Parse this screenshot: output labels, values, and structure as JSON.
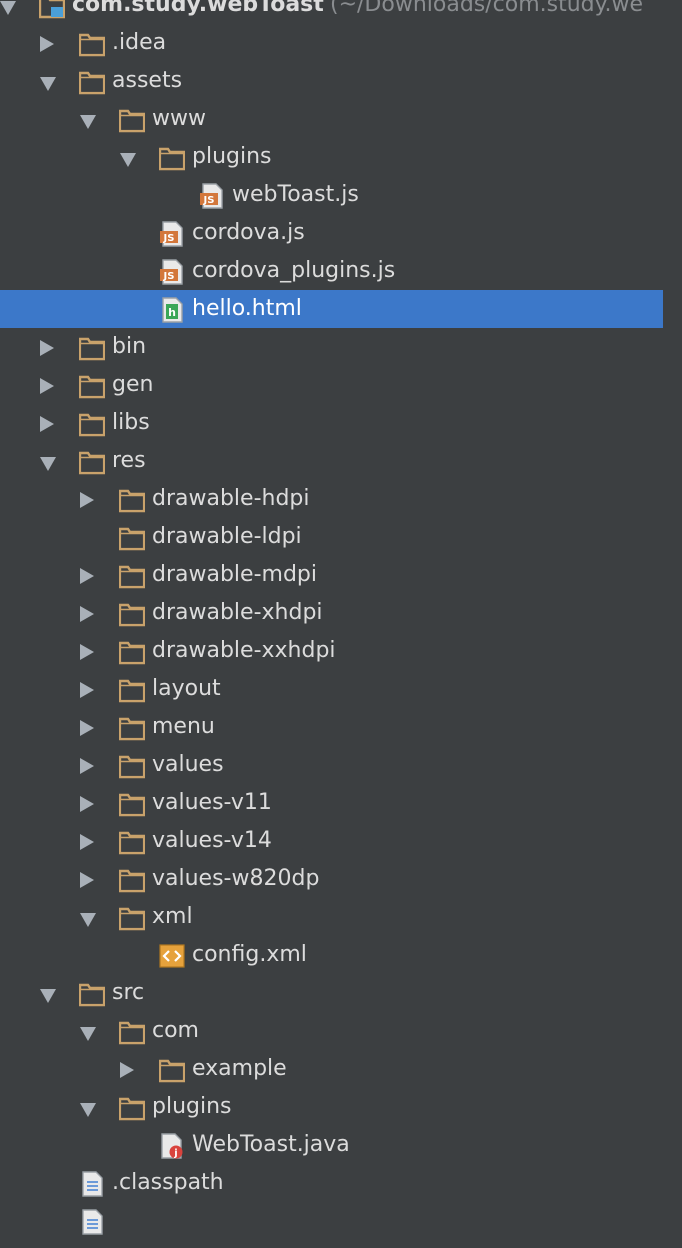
{
  "window": {
    "title": "com.study.webToast"
  },
  "tree": [
    {
      "label": "com.study.webToast",
      "suffix": " (~/Downloads/com.study.we",
      "depth": 0,
      "type": "module",
      "arrow": "expanded",
      "name": "tree-root"
    },
    {
      "label": ".idea",
      "depth": 1,
      "type": "folder",
      "arrow": "collapsed",
      "name": "tree-item-idea"
    },
    {
      "label": "assets",
      "depth": 1,
      "type": "folder",
      "arrow": "expanded",
      "name": "tree-item-assets"
    },
    {
      "label": "www",
      "depth": 2,
      "type": "folder",
      "arrow": "expanded",
      "name": "tree-item-www"
    },
    {
      "label": "plugins",
      "depth": 3,
      "type": "folder",
      "arrow": "expanded",
      "name": "tree-item-www-plugins"
    },
    {
      "label": "webToast.js",
      "depth": 4,
      "type": "js",
      "arrow": "none",
      "name": "tree-item-webtoast-js"
    },
    {
      "label": "cordova.js",
      "depth": 3,
      "type": "js",
      "arrow": "none",
      "name": "tree-item-cordova-js"
    },
    {
      "label": "cordova_plugins.js",
      "depth": 3,
      "type": "js",
      "arrow": "none",
      "name": "tree-item-cordova-plugins-js"
    },
    {
      "label": "hello.html",
      "depth": 3,
      "type": "html",
      "arrow": "none",
      "selected": true,
      "name": "tree-item-hello-html"
    },
    {
      "label": "bin",
      "depth": 1,
      "type": "folder",
      "arrow": "collapsed",
      "name": "tree-item-bin"
    },
    {
      "label": "gen",
      "depth": 1,
      "type": "folder",
      "arrow": "collapsed",
      "name": "tree-item-gen"
    },
    {
      "label": "libs",
      "depth": 1,
      "type": "folder",
      "arrow": "collapsed",
      "name": "tree-item-libs"
    },
    {
      "label": "res",
      "depth": 1,
      "type": "folder",
      "arrow": "expanded",
      "name": "tree-item-res"
    },
    {
      "label": "drawable-hdpi",
      "depth": 2,
      "type": "folder",
      "arrow": "collapsed",
      "name": "tree-item-drawable-hdpi"
    },
    {
      "label": "drawable-ldpi",
      "depth": 2,
      "type": "folder",
      "arrow": "none",
      "name": "tree-item-drawable-ldpi"
    },
    {
      "label": "drawable-mdpi",
      "depth": 2,
      "type": "folder",
      "arrow": "collapsed",
      "name": "tree-item-drawable-mdpi"
    },
    {
      "label": "drawable-xhdpi",
      "depth": 2,
      "type": "folder",
      "arrow": "collapsed",
      "name": "tree-item-drawable-xhdpi"
    },
    {
      "label": "drawable-xxhdpi",
      "depth": 2,
      "type": "folder",
      "arrow": "collapsed",
      "name": "tree-item-drawable-xxhdpi"
    },
    {
      "label": "layout",
      "depth": 2,
      "type": "folder",
      "arrow": "collapsed",
      "name": "tree-item-layout"
    },
    {
      "label": "menu",
      "depth": 2,
      "type": "folder",
      "arrow": "collapsed",
      "name": "tree-item-menu"
    },
    {
      "label": "values",
      "depth": 2,
      "type": "folder",
      "arrow": "collapsed",
      "name": "tree-item-values"
    },
    {
      "label": "values-v11",
      "depth": 2,
      "type": "folder",
      "arrow": "collapsed",
      "name": "tree-item-values-v11"
    },
    {
      "label": "values-v14",
      "depth": 2,
      "type": "folder",
      "arrow": "collapsed",
      "name": "tree-item-values-v14"
    },
    {
      "label": "values-w820dp",
      "depth": 2,
      "type": "folder",
      "arrow": "collapsed",
      "name": "tree-item-values-w820dp"
    },
    {
      "label": "xml",
      "depth": 2,
      "type": "folder",
      "arrow": "expanded",
      "name": "tree-item-xml"
    },
    {
      "label": "config.xml",
      "depth": 3,
      "type": "xml",
      "arrow": "none",
      "name": "tree-item-config-xml"
    },
    {
      "label": "src",
      "depth": 1,
      "type": "folder",
      "arrow": "expanded",
      "name": "tree-item-src"
    },
    {
      "label": "com",
      "depth": 2,
      "type": "folder",
      "arrow": "expanded",
      "name": "tree-item-com"
    },
    {
      "label": "example",
      "depth": 3,
      "type": "folder",
      "arrow": "collapsed",
      "name": "tree-item-example"
    },
    {
      "label": "plugins",
      "depth": 2,
      "type": "folder",
      "arrow": "expanded",
      "name": "tree-item-src-plugins"
    },
    {
      "label": "WebToast.java",
      "depth": 3,
      "type": "java",
      "arrow": "none",
      "name": "tree-item-webtoast-java"
    },
    {
      "label": ".classpath",
      "depth": 1,
      "type": "text",
      "arrow": "none",
      "name": "tree-item-classpath"
    },
    {
      "label": "",
      "depth": 1,
      "type": "text",
      "arrow": "none",
      "name": "tree-item-partial"
    }
  ],
  "colors": {
    "background": "#3c3f41",
    "selection": "#3c78c9",
    "folder": "#c9a26b",
    "js_badge": "#d3773b",
    "html_badge": "#3aa657",
    "java_badge": "#d9433d",
    "text": "#dcdcdc"
  }
}
